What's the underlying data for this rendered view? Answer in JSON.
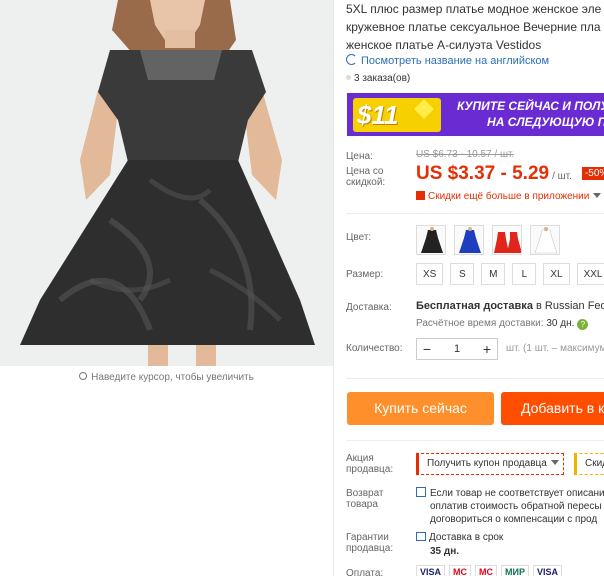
{
  "image": {
    "zoom_hint": "Наведите курсор, чтобы увеличить"
  },
  "product": {
    "title_lines": [
      "5XL плюс размер платье модное женское эле",
      "кружевное платье сексуальное Вечерние пла",
      "женское платье А-силуэта Vestidos"
    ],
    "translate_link": "Посмотреть название на английском",
    "orders": "3 заказа(ов)"
  },
  "banner": {
    "amount": "$11",
    "line1": "КУПИТЕ СЕЙЧАС И ПОЛУ",
    "line2": "НА СЛЕДУЮЩУЮ П"
  },
  "price": {
    "label_price": "Цена:",
    "old_price": "US $6.73 - 10.57 / шт.",
    "label_discount": "Цена со скидкой:",
    "current_price": "US $3.37 - 5.29",
    "unit": "/ шт.",
    "discount_badge": "-50%",
    "app_deal": "Скидки ещё больше в приложении"
  },
  "options": {
    "color_label": "Цвет:",
    "colors": [
      "black",
      "blue",
      "red",
      "white"
    ],
    "size_label": "Размер:",
    "sizes": [
      "XS",
      "S",
      "M",
      "L",
      "XL",
      "XXL"
    ]
  },
  "shipping": {
    "label": "Доставка:",
    "free": "Бесплатная доставка",
    "to": " в Russian Federa",
    "estimate_label": "Расчётное время доставки:",
    "estimate_value": "30 дн."
  },
  "quantity": {
    "label": "Количество:",
    "minus": "−",
    "value": "1",
    "plus": "+",
    "note": "шт. (1 шт. – максимум"
  },
  "actions": {
    "buy_now": "Купить сейчас",
    "add_to_cart": "Добавить в к"
  },
  "seller": {
    "promo_label_1": "Акция",
    "promo_label_2": "продавца:",
    "coupon": "Получить купон продавца",
    "coupon2": "Скид",
    "return_label_1": "Возврат",
    "return_label_2": "товара",
    "return_line1": "Если товар не соответствует описани",
    "return_line2": "оплатив стоимость обратной пересы",
    "return_line3": "договориться о компенсации с прод",
    "guarantee_label_1": "Гарантии",
    "guarantee_label_2": "продавца:",
    "guarantee_line1": "Доставка в срок",
    "guarantee_line2": "35 дн.",
    "payment_label": "Оплата:",
    "payment_methods": [
      "VISA",
      "MC",
      "MC",
      "МИР",
      "VISA"
    ]
  },
  "colors": {
    "accent_red": "#e62e04",
    "buy_orange": "#ff8f2a",
    "cart_orange": "#ff4e00",
    "banner_purple": "#6a2bd3",
    "banner_yellow": "#f6d000",
    "link_blue": "#2b6fb6"
  }
}
